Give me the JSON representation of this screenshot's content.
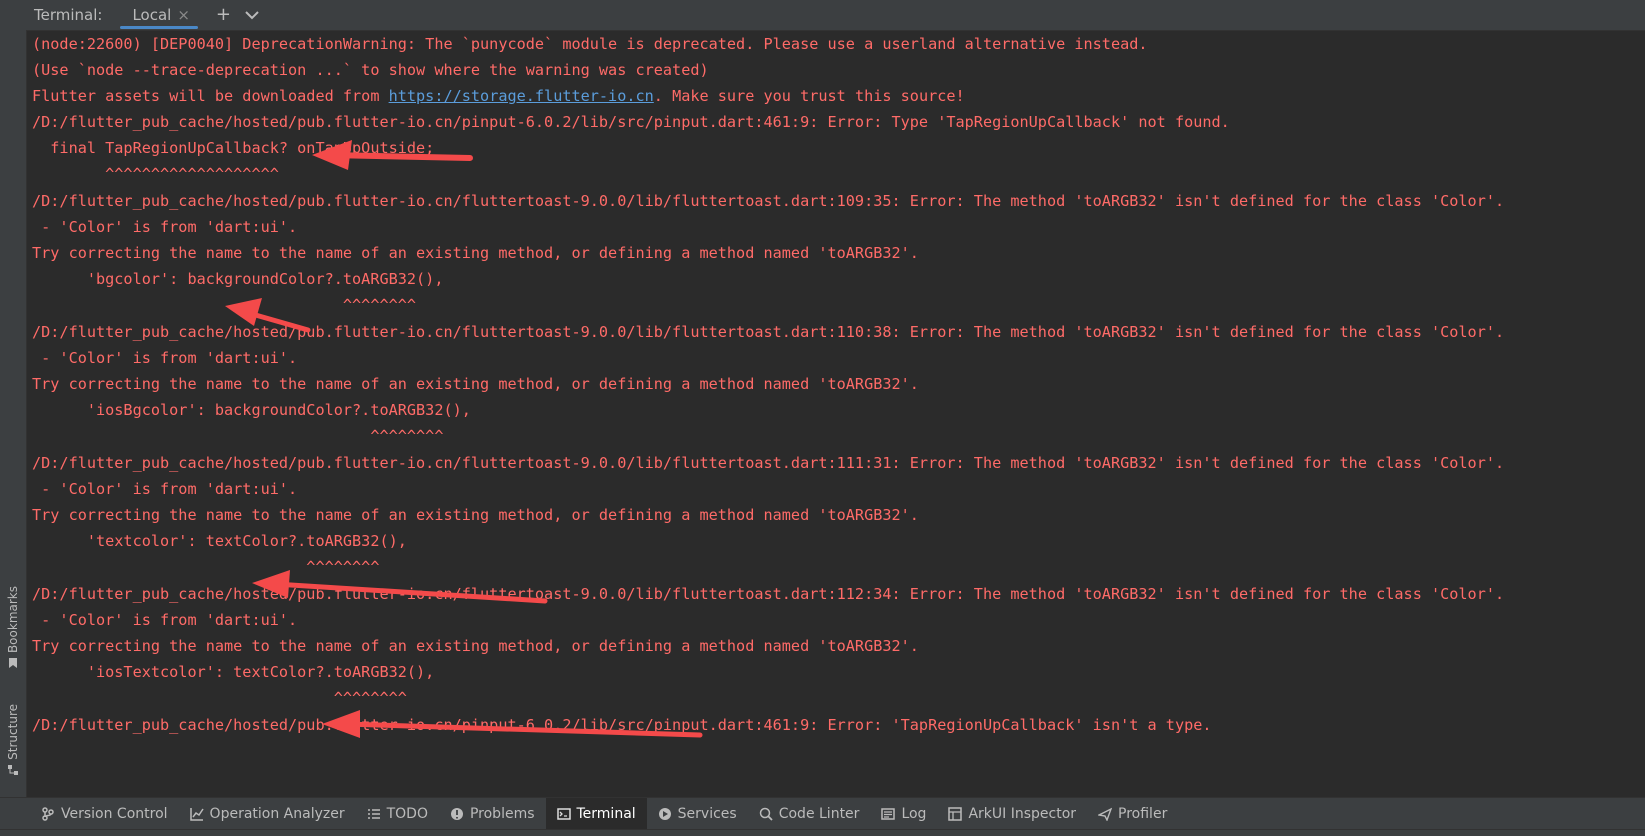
{
  "header": {
    "title": "Terminal:",
    "tab_label": "Local",
    "close_glyph": "×",
    "add_glyph": "+",
    "dropdown_glyph": "⌄"
  },
  "side_tabs": {
    "bookmarks": "Bookmarks",
    "structure": "Structure"
  },
  "terminal_lines": [
    "(node:22600) [DEP0040] DeprecationWarning: The `punycode` module is deprecated. Please use a userland alternative instead.",
    "(Use `node --trace-deprecation ...` to show where the warning was created)",
    "/D:/flutter_pub_cache/hosted/pub.flutter-io.cn/pinput-6.0.2/lib/src/pinput.dart:461:9: Error: Type 'TapRegionUpCallback' not found.",
    "  final TapRegionUpCallback? onTapUpOutside;",
    "        ^^^^^^^^^^^^^^^^^^^",
    "/D:/flutter_pub_cache/hosted/pub.flutter-io.cn/fluttertoast-9.0.0/lib/fluttertoast.dart:109:35: Error: The method 'toARGB32' isn't defined for the class 'Color'.",
    " - 'Color' is from 'dart:ui'.",
    "Try correcting the name to the name of an existing method, or defining a method named 'toARGB32'.",
    "      'bgcolor': backgroundColor?.toARGB32(),",
    "                                  ^^^^^^^^",
    "/D:/flutter_pub_cache/hosted/pub.flutter-io.cn/fluttertoast-9.0.0/lib/fluttertoast.dart:110:38: Error: The method 'toARGB32' isn't defined for the class 'Color'.",
    " - 'Color' is from 'dart:ui'.",
    "Try correcting the name to the name of an existing method, or defining a method named 'toARGB32'.",
    "      'iosBgcolor': backgroundColor?.toARGB32(),",
    "                                     ^^^^^^^^",
    "/D:/flutter_pub_cache/hosted/pub.flutter-io.cn/fluttertoast-9.0.0/lib/fluttertoast.dart:111:31: Error: The method 'toARGB32' isn't defined for the class 'Color'.",
    " - 'Color' is from 'dart:ui'.",
    "Try correcting the name to the name of an existing method, or defining a method named 'toARGB32'.",
    "      'textcolor': textColor?.toARGB32(),",
    "                              ^^^^^^^^",
    "/D:/flutter_pub_cache/hosted/pub.flutter-io.cn/fluttertoast-9.0.0/lib/fluttertoast.dart:112:34: Error: The method 'toARGB32' isn't defined for the class 'Color'.",
    " - 'Color' is from 'dart:ui'.",
    "Try correcting the name to the name of an existing method, or defining a method named 'toARGB32'.",
    "      'iosTextcolor': textColor?.toARGB32(),",
    "                                 ^^^^^^^^",
    "/D:/flutter_pub_cache/hosted/pub.flutter-io.cn/pinput-6.0.2/lib/src/pinput.dart:461:9: Error: 'TapRegionUpCallback' isn't a type."
  ],
  "assets_line": {
    "prefix": "Flutter assets will be downloaded from ",
    "link": "https://storage.flutter-io.cn",
    "suffix": ". Make sure you trust this source!"
  },
  "bottom_tabs": [
    {
      "label": "Version Control",
      "icon": "branch-icon"
    },
    {
      "label": "Operation Analyzer",
      "icon": "chart-icon"
    },
    {
      "label": "TODO",
      "icon": "list-icon"
    },
    {
      "label": "Problems",
      "icon": "problems-icon"
    },
    {
      "label": "Terminal",
      "icon": "terminal-icon",
      "active": true
    },
    {
      "label": "Services",
      "icon": "services-icon"
    },
    {
      "label": "Code Linter",
      "icon": "linter-icon"
    },
    {
      "label": "Log",
      "icon": "log-icon"
    },
    {
      "label": "ArkUI Inspector",
      "icon": "inspector-icon"
    },
    {
      "label": "Profiler",
      "icon": "profiler-icon"
    }
  ],
  "colors": {
    "error_text": "#ff6b68",
    "link": "#5b9ddb",
    "background": "#2b2b2b",
    "annotation_arrow": "#f44a4a"
  }
}
